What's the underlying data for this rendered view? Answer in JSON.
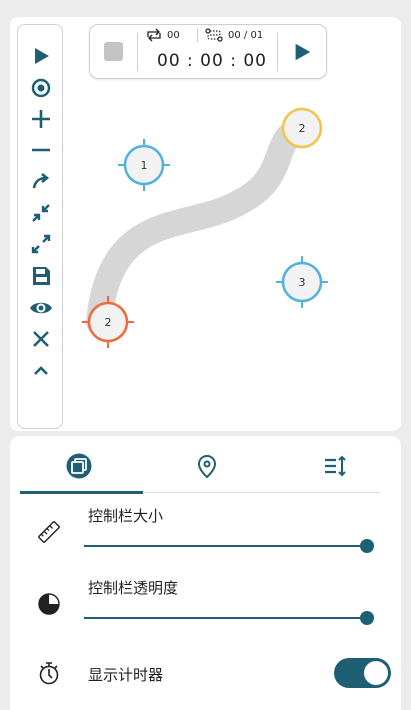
{
  "timer": {
    "loop_count": "00",
    "route_progress": "00 / 01",
    "elapsed": "00 : 00 : 00"
  },
  "toolbar": {
    "tools": [
      "play-icon",
      "target-icon",
      "plus-icon",
      "minus-icon",
      "curve-arrow-icon",
      "collapse-icon",
      "expand-icon",
      "save-icon",
      "eye-icon",
      "close-icon",
      "chevron-up-icon"
    ]
  },
  "map": {
    "points": [
      {
        "label": "1",
        "color": "#4fb3dd"
      },
      {
        "label": "2",
        "color": "#f3c34a"
      },
      {
        "label": "2",
        "color": "#ef6a3c"
      },
      {
        "label": "3",
        "color": "#4fb3dd"
      }
    ]
  },
  "settings": {
    "tabs": [
      "layers-icon",
      "location-pin-icon",
      "list-sort-icon"
    ],
    "active_tab": 0,
    "control_size_label": "控制栏大小",
    "control_size_value": 1.0,
    "control_opacity_label": "控制栏透明度",
    "control_opacity_value": 1.0,
    "show_timer_label": "显示计时器",
    "show_timer_on": true
  },
  "colors": {
    "accent": "#1f5f73",
    "point_blue": "#4fb3dd",
    "point_yellow": "#f3c34a",
    "point_orange": "#ef6a3c",
    "path_gray": "#d6d6d6"
  }
}
